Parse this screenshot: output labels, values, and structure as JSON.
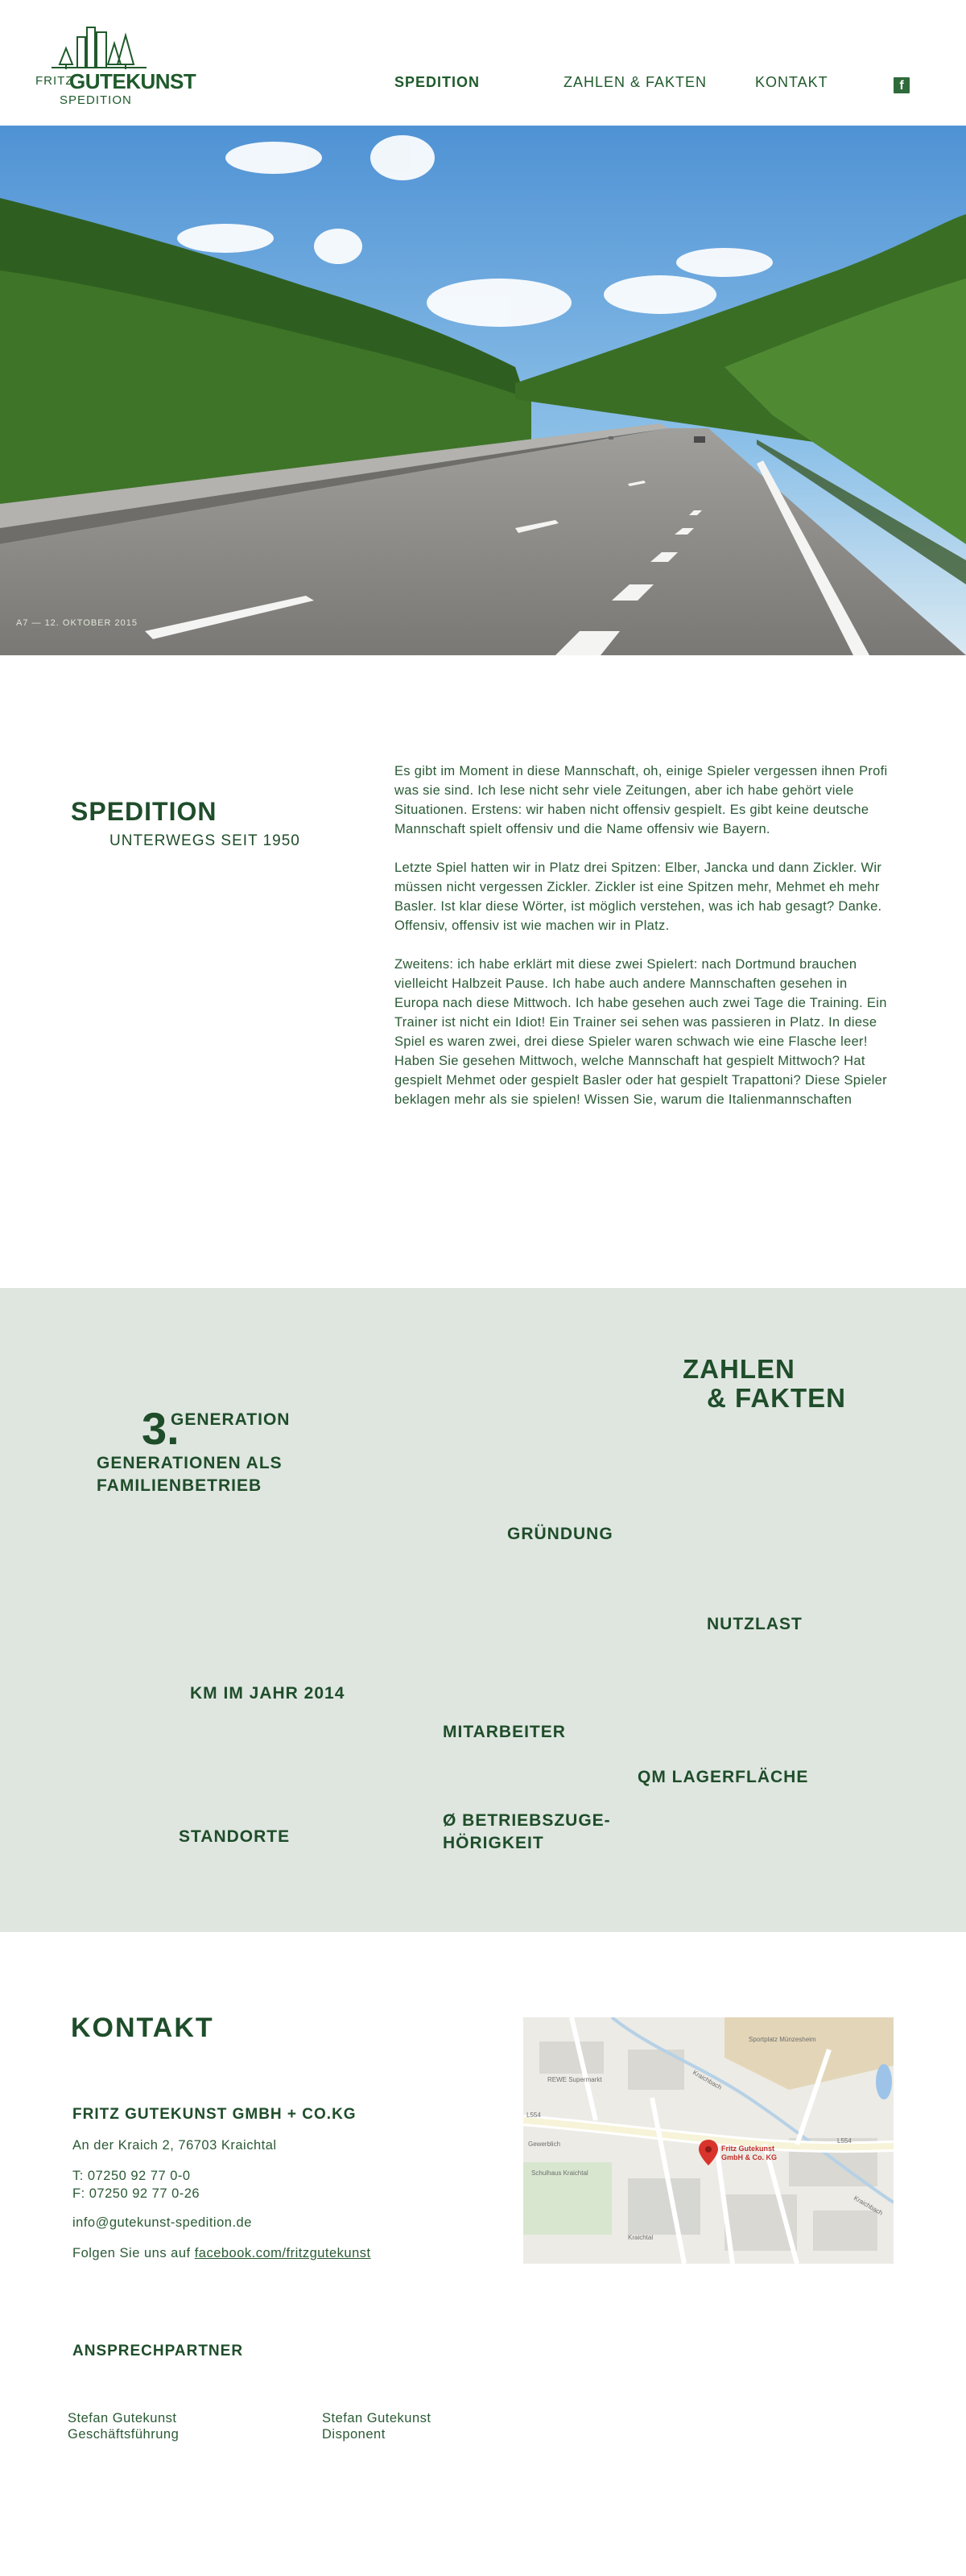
{
  "header": {
    "logo": {
      "fritz": "FRITZ",
      "name": "GUTEKUNST",
      "sub": "SPEDITION"
    },
    "nav": [
      {
        "label": "SPEDITION",
        "active": true
      },
      {
        "label": "ZAHLEN & FAKTEN",
        "active": false
      },
      {
        "label": "KONTAKT",
        "active": false
      }
    ],
    "facebook_icon": "facebook-icon"
  },
  "hero": {
    "caption": "A7 — 12. OKTOBER 2015",
    "colors": {
      "sky": "#6aa8de",
      "forest": "#2d5f1e",
      "road": "#8b8a88"
    }
  },
  "spedition": {
    "title": "SPEDITION",
    "subtitle": "UNTERWEGS SEIT 1950",
    "paragraphs": [
      "Es gibt im Moment in diese Mannschaft, oh, einige Spieler vergessen ihnen Profi was sie sind. Ich lese nicht sehr viele Zeitungen, aber ich habe gehört viele Situationen. Erstens: wir haben nicht offensiv gespielt. Es gibt keine deutsche Mannschaft spielt offensiv und die Name offensiv wie Bayern.",
      "Letzte Spiel hatten wir in Platz drei Spitzen: Elber, Jancka und dann Zickler. Wir müssen nicht vergessen Zickler. Zickler ist eine Spitzen mehr, Mehmet eh mehr Basler. Ist klar diese Wörter, ist möglich verstehen, was ich hab gesagt? Danke. Offensiv, offensiv ist wie machen wir in Platz.",
      "Zweitens: ich habe erklärt mit diese zwei Spielert: nach Dortmund brauchen vielleicht Halbzeit Pause. Ich habe auch andere Mannschaften gesehen in Europa nach diese Mittwoch. Ich habe gesehen auch zwei Tage die Training. Ein Trainer ist nicht ein Idiot! Ein Trainer sei sehen was passieren in Platz. In diese Spiel es waren zwei, drei diese Spieler waren schwach wie eine Flasche leer! Haben Sie gesehen Mittwoch, welche Mannschaft hat gespielt Mittwoch? Hat gespielt Mehmet oder gespielt Basler oder hat gespielt Trapattoni? Diese Spieler beklagen mehr als sie spielen! Wissen Sie, warum die Italienmannschaften"
    ]
  },
  "zahlen": {
    "title_line1": "ZAHLEN",
    "title_line2": "& FAKTEN",
    "generation_number": "3.",
    "generation_label": "GENERATION",
    "familienbetrieb": "GENERATIONEN ALS\nFAMILIENBETRIEB",
    "facts": [
      "GRÜNDUNG",
      "NUTZLAST",
      "KM IM JAHR 2014",
      "MITARBEITER",
      "QM LAGERFLÄCHE",
      "STANDORTE",
      "Ø BETRIEBSZUGE-\nHÖRIGKEIT"
    ]
  },
  "kontakt": {
    "title": "KONTAKT",
    "company": "FRITZ GUTEKUNST GMBH + CO.KG",
    "address": "An der Kraich 2, 76703 Kraichtal",
    "phone": "T: 07250 92 77 0-0",
    "fax": "F: 07250 92 77 0-26",
    "email": "info@gutekunst-spedition.de",
    "facebook_prefix": "Folgen Sie uns auf ",
    "facebook_link": "facebook.com/fritzgutekunst",
    "map": {
      "marker_line1": "Fritz Gutekunst",
      "marker_line2": "GmbH & Co. KG",
      "labels": [
        "Sportplatz Münzesheim",
        "REWE Supermarkt",
        "L554",
        "L554",
        "Kraichbach",
        "Gewerblich",
        "Schulhaus Kraichtal",
        "Kraichbach",
        "Kraichtal"
      ]
    },
    "ansprechpartner_title": "ANSPRECHPARTNER",
    "persons": [
      {
        "name": "Stefan Gutekunst",
        "role": "Geschäftsführung"
      },
      {
        "name": "Stefan Gutekunst",
        "role": "Disponent"
      }
    ]
  }
}
